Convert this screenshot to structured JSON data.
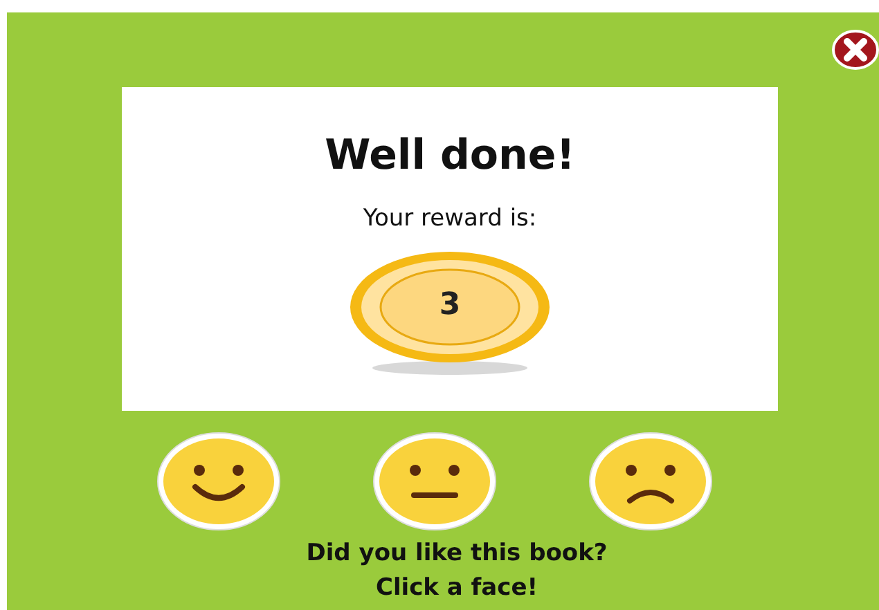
{
  "dialog": {
    "title": "Well done!",
    "subtitle": "Your reward is:",
    "reward": "3"
  },
  "faces": [
    {
      "kind": "happy"
    },
    {
      "kind": "neutral"
    },
    {
      "kind": "sad"
    }
  ],
  "prompt": [
    "Did you like this book?",
    "Click a face!"
  ]
}
